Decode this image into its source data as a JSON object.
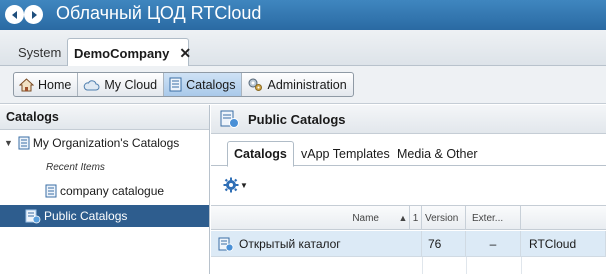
{
  "app": {
    "title": "Облачный ЦОД RTCloud"
  },
  "tabs": [
    {
      "label": "System"
    },
    {
      "label": "DemoCompany",
      "close": "✕"
    }
  ],
  "toolbar": {
    "home": "Home",
    "my_cloud": "My Cloud",
    "catalogs": "Catalogs",
    "administration": "Administration"
  },
  "left": {
    "header": "Catalogs",
    "my_org": "My Organization's Catalogs",
    "recent_items": "Recent Items",
    "company_catalogue": "company catalogue",
    "public_catalogs": "Public Catalogs"
  },
  "right": {
    "title": "Public Catalogs",
    "subtabs": [
      "Catalogs",
      "vApp Templates",
      "Media & Other"
    ],
    "grid": {
      "headers": {
        "name": "Name",
        "sort_index": "1",
        "sort_dir": "▲",
        "version": "Version",
        "external": "Exter..."
      },
      "rows": [
        {
          "name": "Открытый каталог",
          "version": "76",
          "external": "–",
          "owner": "RTCloud"
        }
      ]
    }
  },
  "colors": {
    "titlebar": "#2f74b0",
    "selection": "#2e5d8e",
    "row_highlight": "#dceaf6"
  },
  "icons": {
    "back": "chevron-left-icon",
    "forward": "chevron-right-icon",
    "home": "home-icon",
    "cloud": "cloud-icon",
    "catalog": "catalog-book-icon",
    "admin": "gears-icon",
    "public_catalog": "public-catalog-icon",
    "gear": "gear-icon"
  }
}
